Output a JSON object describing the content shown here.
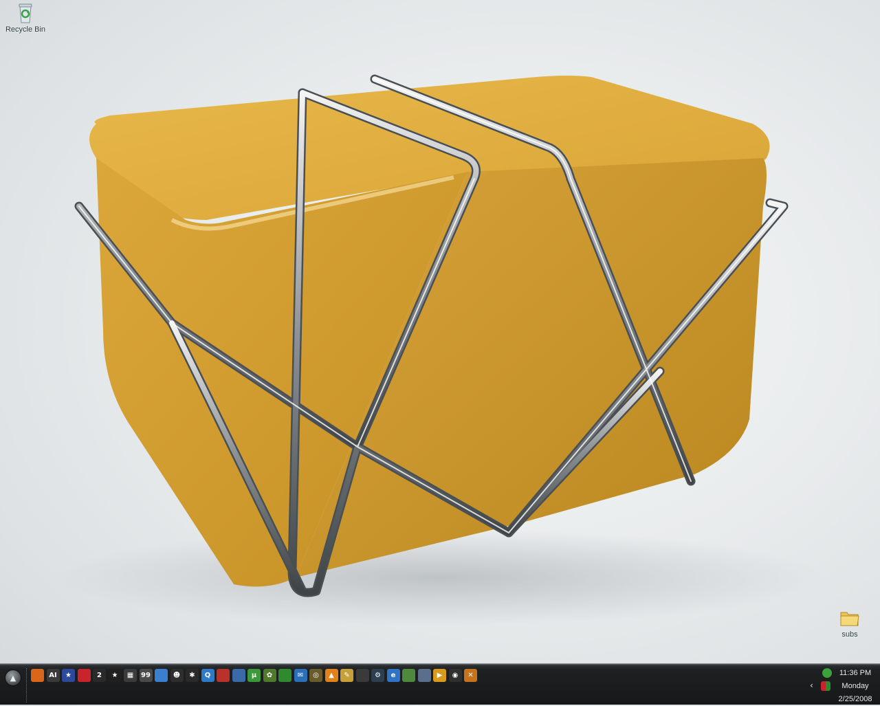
{
  "desktop": {
    "icons": [
      {
        "name": "recycle-bin",
        "label": "Recycle Bin"
      },
      {
        "name": "subs-folder",
        "label": "subs"
      }
    ]
  },
  "taskbar": {
    "start_glyph": "▲",
    "quick_launch": [
      {
        "icon": "firefox-icon",
        "text": "",
        "color": "#d9661b"
      },
      {
        "icon": "aim-icon",
        "text": "AI",
        "color": "#3a3a3a"
      },
      {
        "icon": "star-flag-icon",
        "text": "★",
        "color": "#2c4a9c"
      },
      {
        "icon": "color-blocks-icon",
        "text": "",
        "color": "#c9242b"
      },
      {
        "icon": "number-two-icon",
        "text": "2",
        "color": "#2a2a2a"
      },
      {
        "icon": "black-star-icon",
        "text": "★",
        "color": "#202020"
      },
      {
        "icon": "keyboard-icon",
        "text": "▦",
        "color": "#3b3b3b"
      },
      {
        "icon": "badge-99-icon",
        "text": "99",
        "color": "#4a4a4a"
      },
      {
        "icon": "document-blue-icon",
        "text": "",
        "color": "#3b7fd0"
      },
      {
        "icon": "robot-icon",
        "text": "☻",
        "color": "#2e2e2e"
      },
      {
        "icon": "spider-icon",
        "text": "✱",
        "color": "#2a2a2a"
      },
      {
        "icon": "q-blue-icon",
        "text": "Q",
        "color": "#2d7bc8"
      },
      {
        "icon": "red-app-icon",
        "text": "",
        "color": "#b8322b"
      },
      {
        "icon": "window-icon",
        "text": "",
        "color": "#3a6aa8"
      },
      {
        "icon": "utorrent-icon",
        "text": "µ",
        "color": "#3a9a3a"
      },
      {
        "icon": "palm-icon",
        "text": "✿",
        "color": "#4f7a2c"
      },
      {
        "icon": "green-bar-icon",
        "text": "",
        "color": "#2f8a2f"
      },
      {
        "icon": "blue-gear-icon",
        "text": "✉",
        "color": "#2b6fb8"
      },
      {
        "icon": "clock-app-icon",
        "text": "◎",
        "color": "#6a5c2a"
      },
      {
        "icon": "vlc-icon",
        "text": "▲",
        "color": "#e2801a"
      },
      {
        "icon": "pencil-icon",
        "text": "✎",
        "color": "#c8a03a"
      },
      {
        "icon": "terminal-icon",
        "text": "",
        "color": "#3a3a3a"
      },
      {
        "icon": "steam-icon",
        "text": "⚙",
        "color": "#2c3e50"
      },
      {
        "icon": "ie-icon",
        "text": "e",
        "color": "#2f73c4"
      },
      {
        "icon": "image-viewer-icon",
        "text": "",
        "color": "#4d8a3c"
      },
      {
        "icon": "monitor-icon",
        "text": "",
        "color": "#5a6f8c"
      },
      {
        "icon": "media-player-icon",
        "text": "▶",
        "color": "#d79b1d"
      },
      {
        "icon": "eye-icon",
        "text": "◉",
        "color": "#2f2f2f"
      },
      {
        "icon": "tools-icon",
        "text": "✕",
        "color": "#c7731b"
      }
    ],
    "tray": {
      "chevron": "‹",
      "icons": [
        {
          "icon": "utorrent-tray-icon",
          "color": "#3aa33a"
        },
        {
          "icon": "color-blocks-tray-icon",
          "color": "#c9242b"
        }
      ]
    },
    "clock": {
      "time": "11:36 PM",
      "day": "Monday",
      "date": "2/25/2008"
    }
  }
}
